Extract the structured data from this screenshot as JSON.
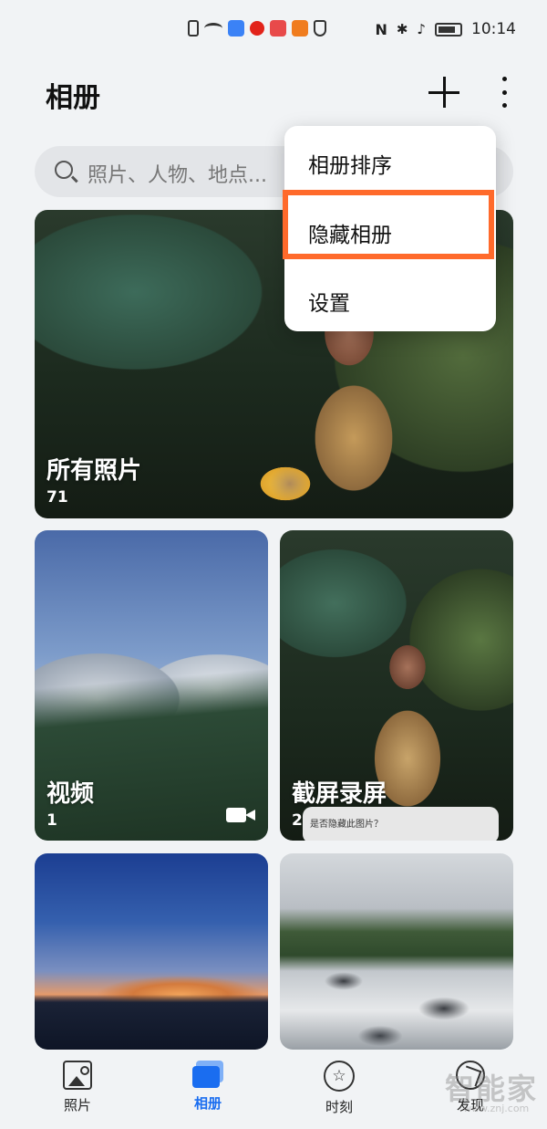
{
  "status_bar": {
    "time": "10:14"
  },
  "header": {
    "title": "相册"
  },
  "search": {
    "placeholder": "照片、人物、地点..."
  },
  "albums": [
    {
      "name": "所有照片",
      "count": "71"
    },
    {
      "name": "视频",
      "count": "1"
    },
    {
      "name": "截屏录屏",
      "count": "2"
    }
  ],
  "hint_text": "是否隐藏此图片？",
  "menu": {
    "items": [
      "相册排序",
      "隐藏相册",
      "设置"
    ],
    "highlighted_item": "隐藏相册",
    "highlight_color": "#ff6a2b"
  },
  "bottom_nav": {
    "tabs": [
      "照片",
      "相册",
      "时刻",
      "发现"
    ],
    "active": "相册",
    "active_color": "#1a6df0"
  },
  "watermark": {
    "text": "智能家",
    "sub": "www.znj.com"
  }
}
